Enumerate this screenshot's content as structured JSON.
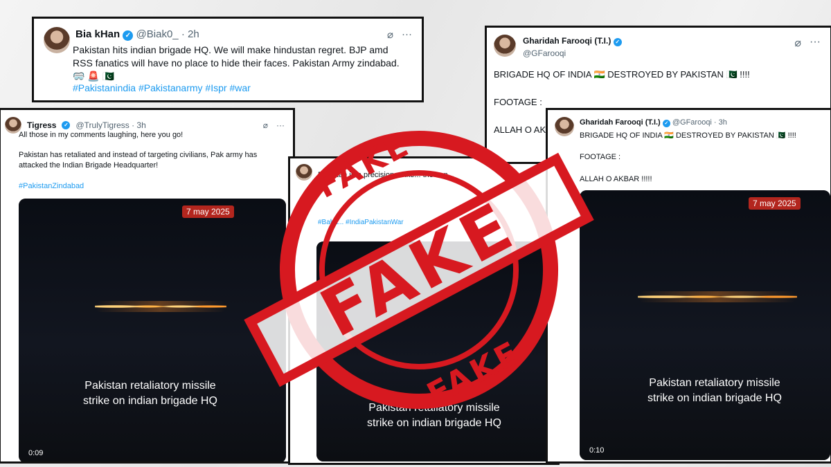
{
  "colors": {
    "stamp_red": "#d71920",
    "link_blue": "#1d9bf0",
    "badge_red": "#b3261e"
  },
  "posts": {
    "bia": {
      "name": "Bia kHan",
      "handle": "@Biak0_",
      "time": "· 2h",
      "body": "Pakistan hits indian brigade HQ. We will make hindustan regret. BJP amd RSS fanatics will have no place to hide their faces. Pakistan Army zindabad.🥽 🚨 🇵🇰",
      "hashtags": "#Pakistanindia #Pakistanarmy #Ispr #war"
    },
    "tigress": {
      "name": "Tigress",
      "handle": "@TrulyTigress · 3h",
      "line1": "All those in my comments laughing, here you go!",
      "line2": "Pakistan has retaliated and instead of targeting civilians, Pak army has attacked the Indian Brigade Headquarter!",
      "hashtags": "#PakistanZindabad",
      "video_date": "7 may 2025",
      "video_caption": "Pakistan retaliatory missile strike on indian brigade HQ",
      "video_time": "0:09"
    },
    "middle": {
      "text": "Pakistan in a precision strike... the con...",
      "hashtags": "#Baha... #IndiaPakistanWar",
      "video_caption": "Pakistan retaliatory missile strike on indian brigade HQ"
    },
    "gharidah_back": {
      "name": "Gharidah Farooqi (T.I.)",
      "handle": "@GFarooqi",
      "line1": "BRIGADE HQ OF INDIA 🇮🇳 DESTROYED BY PAKISTAN 🇵🇰 !!!!",
      "line2": "FOOTAGE :",
      "line3": "ALLAH O AK..."
    },
    "gharidah_front": {
      "name": "Gharidah Farooqi (T.I.)",
      "handle": "@GFarooqi · 3h",
      "line1": "BRIGADE HQ OF INDIA 🇮🇳 DESTROYED BY PAKISTAN 🇵🇰 !!!!",
      "line2": "FOOTAGE :",
      "line3": "ALLAH O AKBAR !!!!!",
      "video_date": "7 may 2025",
      "video_caption": "Pakistan retaliatory missile strike on indian brigade HQ",
      "video_time": "0:10"
    }
  },
  "stamp": {
    "top": "FAKE",
    "center": "FAKE",
    "bottom": "FAKE"
  }
}
